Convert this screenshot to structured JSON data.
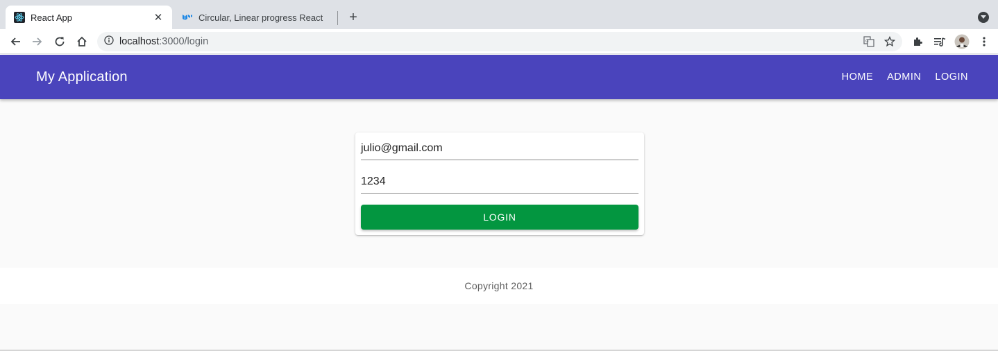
{
  "browser": {
    "tabs": [
      {
        "title": "React App",
        "icon": "react-icon",
        "active": true
      },
      {
        "title": "Circular, Linear progress React",
        "icon": "mui-icon",
        "active": false
      }
    ],
    "url_host": "localhost",
    "url_path": ":3000/login",
    "accent": "#dee1e6"
  },
  "appbar": {
    "title": "My Application",
    "nav": [
      "HOME",
      "ADMIN",
      "LOGIN"
    ],
    "color": "#4a44bc"
  },
  "login_form": {
    "email_value": "julio@gmail.com",
    "password_value": "1234",
    "submit_label": "LOGIN",
    "button_color": "#039640"
  },
  "footer": {
    "text": "Copyright 2021"
  }
}
